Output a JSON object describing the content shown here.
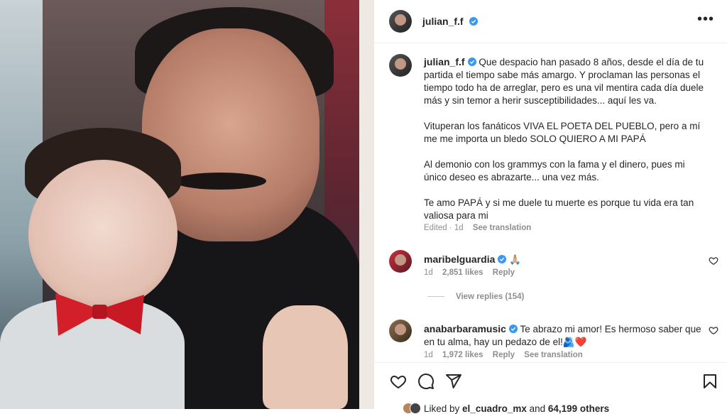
{
  "post": {
    "author": "julian_f.f",
    "caption_paragraphs": [
      "Que despacio han pasado 8 años, desde el día de tu partida el tiempo sabe más amargo. Y proclaman las personas el tiempo todo ha de arreglar, pero es una vil mentira cada día duele más y sin temor a herir susceptibilidades... aquí les va.",
      "Vituperan los fanáticos VIVA EL POETA DEL PUEBLO, pero a mí me me importa un bledo SOLO QUIERO A MI PAPÁ",
      "Al demonio con los grammys con la fama y el dinero, pues mi único deseo es abrazarte... una vez más.",
      "Te amo PAPÁ y si me duele tu muerte es porque tu vida era tan valiosa para mi"
    ],
    "meta": "Edited · 1d",
    "see_translation": "See translation"
  },
  "comments": [
    {
      "author": "maribelguardia",
      "text": "🙏🏼",
      "time": "1d",
      "likes": "2,851 likes",
      "reply": "Reply",
      "view_replies": "View replies (154)"
    },
    {
      "author": "anabarbaramusic",
      "text": "Te abrazo mi amor! Es hermoso saber que en tu alma, hay un pedazo de el!🫂❤️",
      "time": "1d",
      "likes": "1,972 likes",
      "reply": "Reply",
      "see_translation": "See translation"
    }
  ],
  "footer": {
    "liked_prefix": "Liked by ",
    "liked_user": "el_cuadro_mx",
    "liked_and": " and ",
    "liked_others": "64,199 others"
  },
  "colors": {
    "verified": "#3897f0",
    "muted_text": "#8e8e8e",
    "text": "#262626",
    "heart_red": "#ed4956"
  },
  "icons": [
    "verified-badge-icon",
    "more-options-icon",
    "heart-icon",
    "comment-icon",
    "share-icon",
    "bookmark-icon"
  ]
}
